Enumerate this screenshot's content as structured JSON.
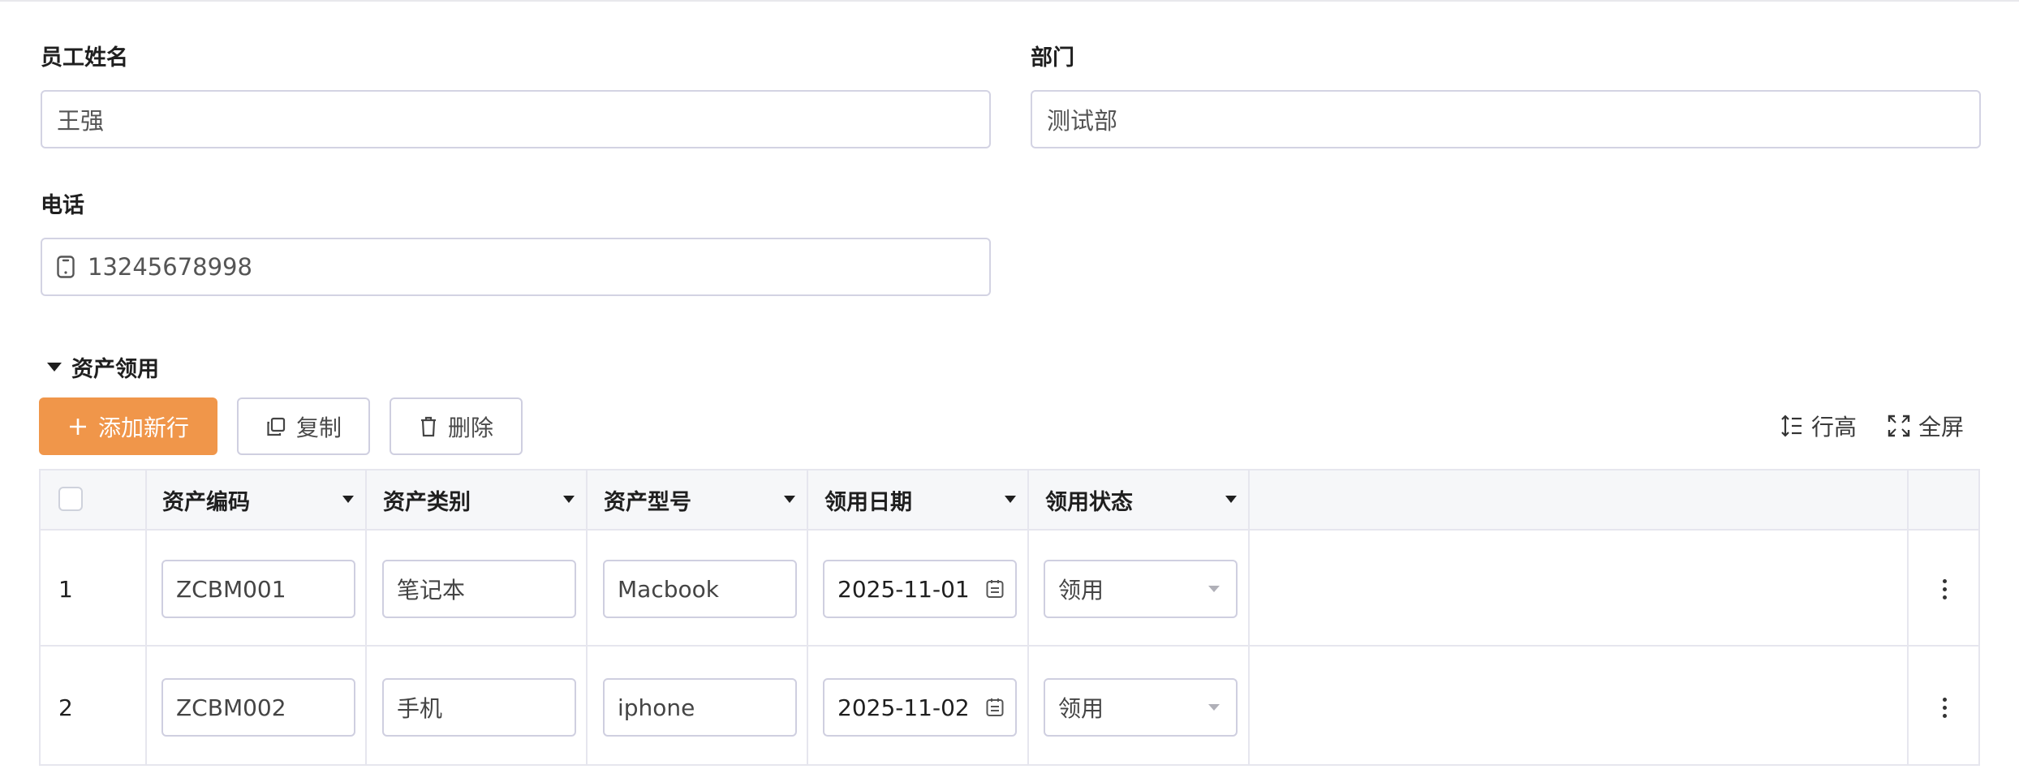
{
  "form": {
    "name_label": "员工姓名",
    "name_value": "王强",
    "dept_label": "部门",
    "dept_value": "测试部",
    "phone_label": "电话",
    "phone_value": "13245678998"
  },
  "section": {
    "title": "资产领用"
  },
  "toolbar": {
    "add_label": "添加新行",
    "copy_label": "复制",
    "delete_label": "删除",
    "row_height_label": "行高",
    "fullscreen_label": "全屏"
  },
  "table": {
    "headers": [
      "资产编码",
      "资产类别",
      "资产型号",
      "领用日期",
      "领用状态"
    ],
    "rows": [
      {
        "index": "1",
        "code": "ZCBM001",
        "category": "笔记本",
        "model": "Macbook",
        "date": "2025-11-01",
        "status": "领用"
      },
      {
        "index": "2",
        "code": "ZCBM002",
        "category": "手机",
        "model": "iphone",
        "date": "2025-11-02",
        "status": "领用"
      }
    ]
  },
  "colors": {
    "primary": "#f0964a",
    "border": "#cfcfe0",
    "header_bg": "#f6f7f9"
  }
}
